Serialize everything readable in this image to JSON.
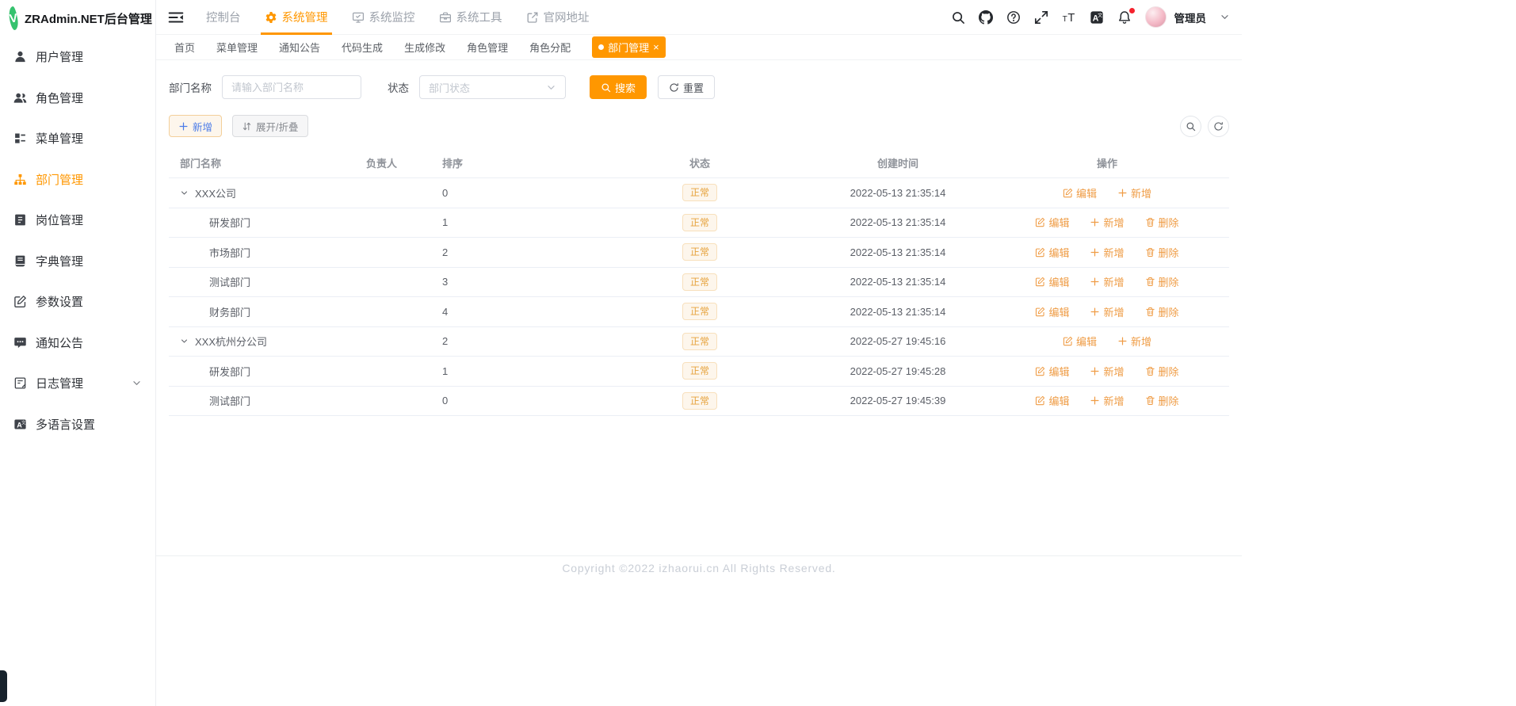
{
  "app": {
    "logo_letter": "V",
    "title": "ZRAdmin.NET后台管理"
  },
  "colors": {
    "accent": "#ff9700",
    "status_bg": "#fdf6ec",
    "status_border": "#f8e0bc",
    "status_text": "#e6a23c",
    "action_link": "#ef9c45"
  },
  "sidebar": {
    "items": [
      {
        "key": "users",
        "icon": "user-icon",
        "label": "用户管理"
      },
      {
        "key": "roles",
        "icon": "users-icon",
        "label": "角色管理"
      },
      {
        "key": "menus",
        "icon": "menu-tree-icon",
        "label": "菜单管理"
      },
      {
        "key": "depts",
        "icon": "org-icon",
        "label": "部门管理",
        "active": true
      },
      {
        "key": "posts",
        "icon": "post-badge-icon",
        "label": "岗位管理"
      },
      {
        "key": "dicts",
        "icon": "dictionary-icon",
        "label": "字典管理"
      },
      {
        "key": "params",
        "icon": "edit-square-icon",
        "label": "参数设置"
      },
      {
        "key": "notices",
        "icon": "comment-icon",
        "label": "通知公告"
      },
      {
        "key": "logs",
        "icon": "log-icon",
        "label": "日志管理",
        "expandable": true
      },
      {
        "key": "i18n",
        "icon": "language-icon",
        "label": "多语言设置"
      }
    ]
  },
  "topbar": {
    "menu": [
      {
        "key": "console",
        "label": "控制台"
      },
      {
        "key": "system-manage",
        "icon": "gear-icon",
        "label": "系统管理",
        "active": true
      },
      {
        "key": "system-monitor",
        "icon": "monitor-icon",
        "label": "系统监控"
      },
      {
        "key": "system-tools",
        "icon": "toolbox-icon",
        "label": "系统工具"
      },
      {
        "key": "website",
        "icon": "external-link-icon",
        "label": "官网地址"
      }
    ],
    "actions": [
      {
        "key": "search",
        "icon": "search-icon"
      },
      {
        "key": "github",
        "icon": "github-icon"
      },
      {
        "key": "help",
        "icon": "help-icon"
      },
      {
        "key": "fullscreen",
        "icon": "fullscreen-icon"
      },
      {
        "key": "font-size",
        "icon": "font-size-icon"
      },
      {
        "key": "language",
        "icon": "translate-icon"
      },
      {
        "key": "notifications",
        "icon": "bell-icon",
        "badge": true
      }
    ],
    "user": {
      "name": "管理员"
    }
  },
  "tabs": [
    {
      "key": "home",
      "label": "首页"
    },
    {
      "key": "menu",
      "label": "菜单管理"
    },
    {
      "key": "notice",
      "label": "通知公告"
    },
    {
      "key": "codegen",
      "label": "代码生成"
    },
    {
      "key": "codegen-edit",
      "label": "生成修改"
    },
    {
      "key": "role",
      "label": "角色管理"
    },
    {
      "key": "role-assign",
      "label": "角色分配"
    },
    {
      "key": "dept",
      "label": "部门管理",
      "active": true,
      "closable": true
    }
  ],
  "filters": {
    "name_label": "部门名称",
    "name_placeholder": "请输入部门名称",
    "status_label": "状态",
    "status_placeholder": "部门状态",
    "search_label": "搜索",
    "reset_label": "重置"
  },
  "toolbar": {
    "add_label": "新增",
    "toggle_label": "展开/折叠"
  },
  "table": {
    "columns": [
      "部门名称",
      "负责人",
      "排序",
      "状态",
      "创建时间",
      "操作"
    ],
    "rows": [
      {
        "name": "XXX公司",
        "leader": "",
        "sort": "0",
        "status": "正常",
        "created": "2022-05-13 21:35:14",
        "level": 0,
        "expanded": true,
        "actions": [
          "编辑",
          "新增"
        ]
      },
      {
        "name": "研发部门",
        "leader": "",
        "sort": "1",
        "status": "正常",
        "created": "2022-05-13 21:35:14",
        "level": 1,
        "expanded": false,
        "actions": [
          "编辑",
          "新增",
          "删除"
        ]
      },
      {
        "name": "市场部门",
        "leader": "",
        "sort": "2",
        "status": "正常",
        "created": "2022-05-13 21:35:14",
        "level": 1,
        "expanded": false,
        "actions": [
          "编辑",
          "新增",
          "删除"
        ]
      },
      {
        "name": "测试部门",
        "leader": "",
        "sort": "3",
        "status": "正常",
        "created": "2022-05-13 21:35:14",
        "level": 1,
        "expanded": false,
        "actions": [
          "编辑",
          "新增",
          "删除"
        ]
      },
      {
        "name": "财务部门",
        "leader": "",
        "sort": "4",
        "status": "正常",
        "created": "2022-05-13 21:35:14",
        "level": 1,
        "expanded": false,
        "actions": [
          "编辑",
          "新增",
          "删除"
        ]
      },
      {
        "name": "XXX杭州分公司",
        "leader": "",
        "sort": "2",
        "status": "正常",
        "created": "2022-05-27 19:45:16",
        "level": 0,
        "expanded": true,
        "actions": [
          "编辑",
          "新增"
        ]
      },
      {
        "name": "研发部门",
        "leader": "",
        "sort": "1",
        "status": "正常",
        "created": "2022-05-27 19:45:28",
        "level": 1,
        "expanded": false,
        "actions": [
          "编辑",
          "新增",
          "删除"
        ]
      },
      {
        "name": "测试部门",
        "leader": "",
        "sort": "0",
        "status": "正常",
        "created": "2022-05-27 19:45:39",
        "level": 1,
        "expanded": false,
        "actions": [
          "编辑",
          "新增",
          "删除"
        ]
      }
    ]
  },
  "footer": {
    "copyright": "Copyright ©2022 izhaorui.cn All Rights Reserved."
  }
}
